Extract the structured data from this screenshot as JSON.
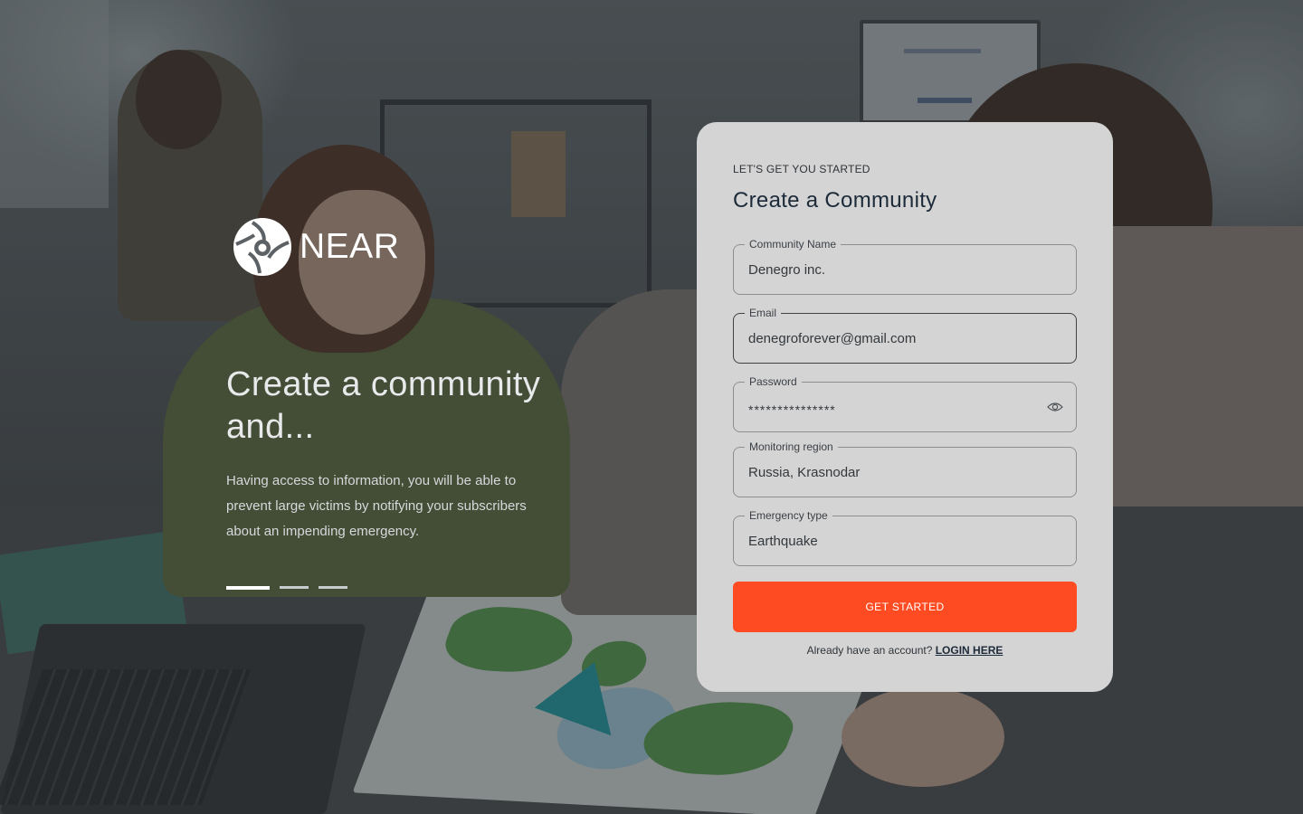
{
  "brand": {
    "name": "NEAR",
    "logo_icon": "near-aperture-logo"
  },
  "hero": {
    "title": "Create a community and...",
    "text": "Having access to information, you will be able to prevent large victims by notifying your subscribers about an impending emergency.",
    "slides": [
      {
        "active": true
      },
      {
        "active": false
      },
      {
        "active": false
      }
    ]
  },
  "form": {
    "eyebrow": "LET'S GET YOU STARTED",
    "title": "Create a Community",
    "fields": [
      {
        "label": "Community Name",
        "value": "Denegro inc."
      },
      {
        "label": "Email",
        "value": "denegroforever@gmail.com",
        "focused": true
      },
      {
        "label": "Password",
        "value": "***************",
        "icon": "eye-icon"
      },
      {
        "label": "Monitoring region",
        "value": "Russia, Krasnodar"
      },
      {
        "label": "Emergency type",
        "value": "Earthquake"
      }
    ],
    "submit_label": "GET STARTED",
    "login_prompt": "Already have an account?",
    "login_link": "LOGIN HERE"
  },
  "colors": {
    "accent": "#ff4b22",
    "card_bg": "#d4d4d4",
    "title": "#1c2a39"
  }
}
